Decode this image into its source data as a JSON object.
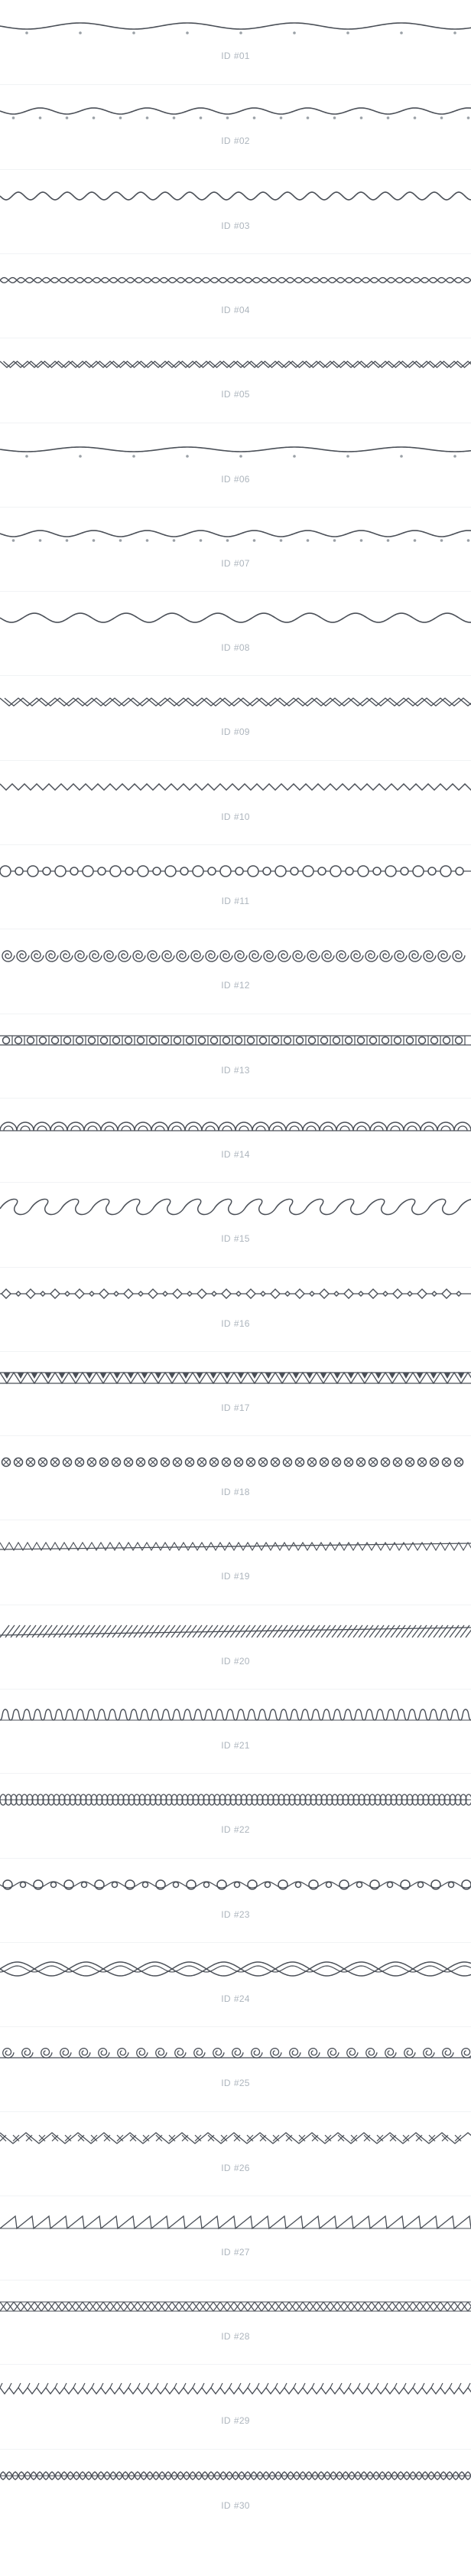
{
  "colors": {
    "stroke": "#4a4f57",
    "dot": "#9aa0a6",
    "label": "#adb5bd",
    "separator": "#f1f3f5"
  },
  "items": [
    {
      "prefix": "ID",
      "id": "#01",
      "style": "wave-dots"
    },
    {
      "prefix": "ID",
      "id": "#02",
      "style": "wave-dots-dense"
    },
    {
      "prefix": "ID",
      "id": "#03",
      "style": "wave"
    },
    {
      "prefix": "ID",
      "id": "#04",
      "style": "double-wave-small"
    },
    {
      "prefix": "ID",
      "id": "#05",
      "style": "double-zigzag"
    },
    {
      "prefix": "ID",
      "id": "#06",
      "style": "gentle-wave-dots"
    },
    {
      "prefix": "ID",
      "id": "#07",
      "style": "wave-dots-dense"
    },
    {
      "prefix": "ID",
      "id": "#08",
      "style": "wave-medium"
    },
    {
      "prefix": "ID",
      "id": "#09",
      "style": "double-zigzag-wide"
    },
    {
      "prefix": "ID",
      "id": "#10",
      "style": "zigzag-fine"
    },
    {
      "prefix": "ID",
      "id": "#11",
      "style": "circle-chain"
    },
    {
      "prefix": "ID",
      "id": "#12",
      "style": "spirals"
    },
    {
      "prefix": "ID",
      "id": "#13",
      "style": "bracket-circles"
    },
    {
      "prefix": "ID",
      "id": "#14",
      "style": "arches"
    },
    {
      "prefix": "ID",
      "id": "#15",
      "style": "scrolls"
    },
    {
      "prefix": "ID",
      "id": "#16",
      "style": "diamond-chain"
    },
    {
      "prefix": "ID",
      "id": "#17",
      "style": "triangle-band"
    },
    {
      "prefix": "ID",
      "id": "#18",
      "style": "cross-circles"
    },
    {
      "prefix": "ID",
      "id": "#19",
      "style": "zigzag-ribbon"
    },
    {
      "prefix": "ID",
      "id": "#20",
      "style": "hatched"
    },
    {
      "prefix": "ID",
      "id": "#21",
      "style": "loops"
    },
    {
      "prefix": "ID",
      "id": "#22",
      "style": "dense-loops"
    },
    {
      "prefix": "ID",
      "id": "#23",
      "style": "ring-chain"
    },
    {
      "prefix": "ID",
      "id": "#24",
      "style": "braid"
    },
    {
      "prefix": "ID",
      "id": "#25",
      "style": "curls"
    },
    {
      "prefix": "ID",
      "id": "#26",
      "style": "x-zigzag"
    },
    {
      "prefix": "ID",
      "id": "#27",
      "style": "slash-zigzag"
    },
    {
      "prefix": "ID",
      "id": "#28",
      "style": "x-chain"
    },
    {
      "prefix": "ID",
      "id": "#29",
      "style": "spiky"
    },
    {
      "prefix": "ID",
      "id": "#30",
      "style": "ribbon-loops"
    }
  ]
}
